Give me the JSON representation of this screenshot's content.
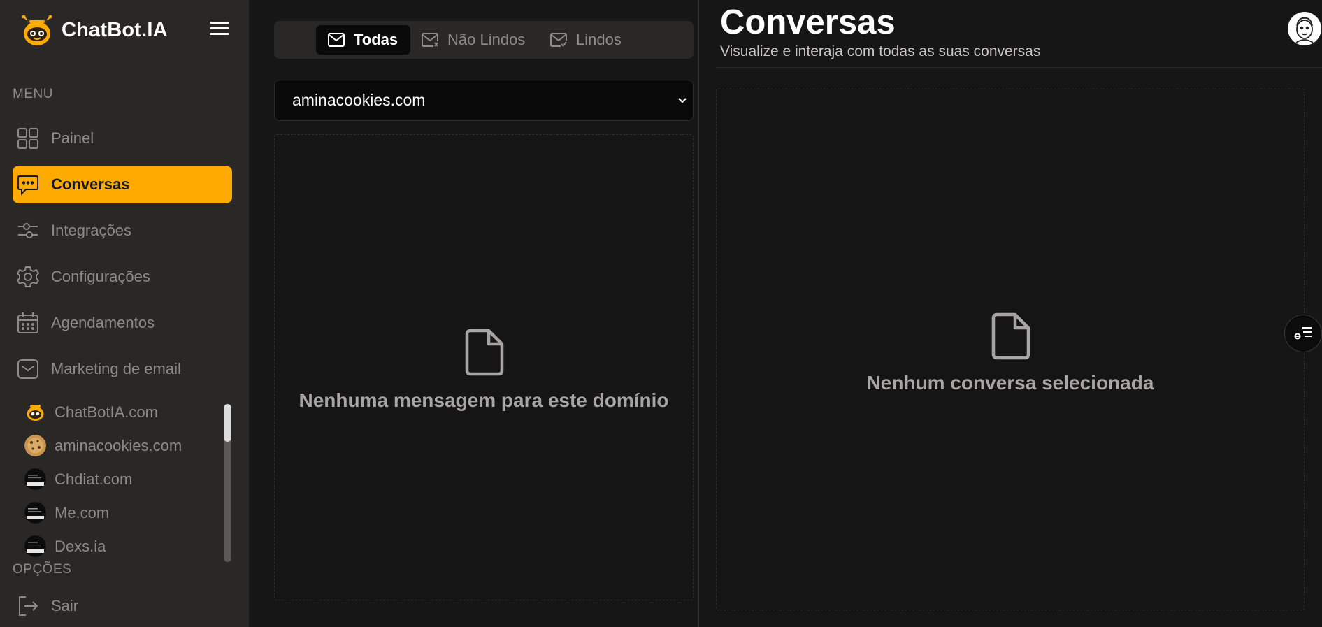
{
  "brand": {
    "name": "ChatBot.IA",
    "logo_icon": "robot-logo-icon"
  },
  "sidebar": {
    "menu_label": "MENU",
    "options_label": "OPÇÕES",
    "items": [
      {
        "label": "Painel",
        "icon": "grid-icon"
      },
      {
        "label": "Conversas",
        "icon": "chat-bubble-icon",
        "active": true
      },
      {
        "label": "Integrações",
        "icon": "sliders-icon"
      },
      {
        "label": "Configurações",
        "icon": "gear-icon"
      },
      {
        "label": "Agendamentos",
        "icon": "calendar-icon"
      },
      {
        "label": "Marketing de email",
        "icon": "mail-icon"
      }
    ],
    "domains": [
      {
        "label": "ChatBotIA.com"
      },
      {
        "label": "aminacookies.com"
      },
      {
        "label": "Chdiat.com"
      },
      {
        "label": "Me.com"
      },
      {
        "label": "Dexs.ia"
      }
    ],
    "logout_label": "Sair",
    "accent_color": "#fdab00"
  },
  "tabs": [
    {
      "label": "Todas",
      "icon": "mail-icon",
      "active": true
    },
    {
      "label": "Não Lindos",
      "icon": "mail-unread-icon"
    },
    {
      "label": "Lindos",
      "icon": "mail-check-icon"
    }
  ],
  "domain_select": {
    "value": "aminacookies.com"
  },
  "messages_panel": {
    "empty_text": "Nenhuma mensagem para este domínio"
  },
  "header": {
    "title": "Conversas",
    "subtitle": "Visualize e interaja com todas as suas conversas"
  },
  "conversation_panel": {
    "empty_text": "Nenhum conversa selecionada"
  }
}
